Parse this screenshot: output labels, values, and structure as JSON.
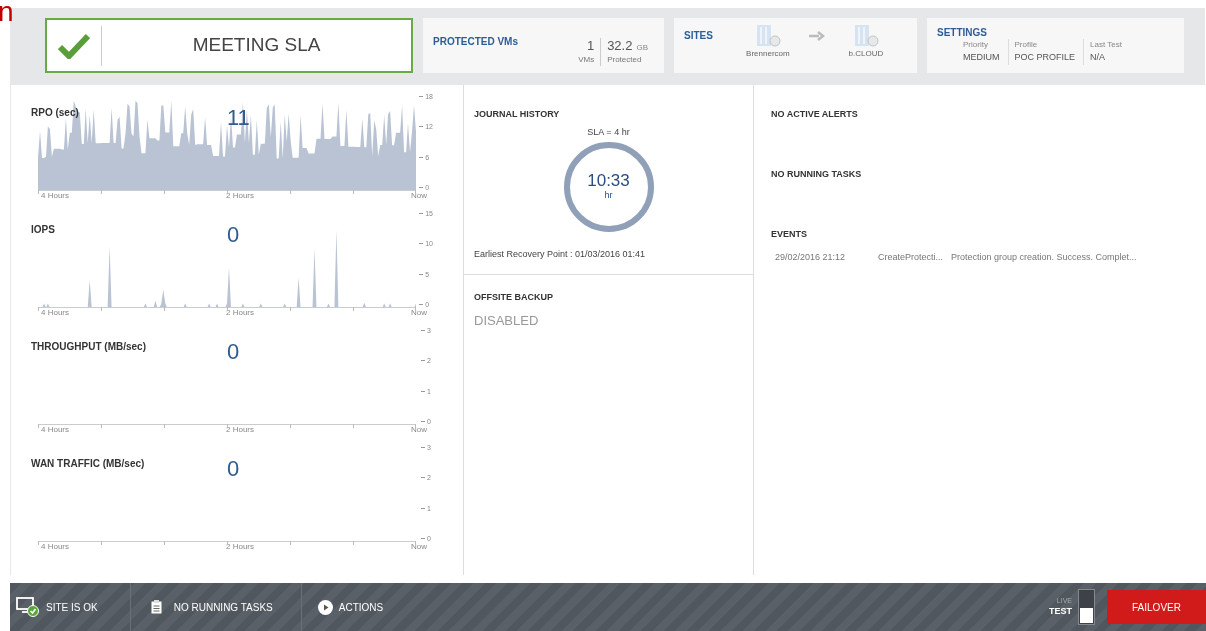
{
  "corner_text": "n",
  "sla_status": {
    "label": "MEETING SLA",
    "ok": true
  },
  "protected_vms": {
    "title": "PROTECTED VMs",
    "count": "1",
    "count_label": "VMs",
    "size": "32.2",
    "size_unit": "GB",
    "size_label": "Protected"
  },
  "sites": {
    "title": "SITES",
    "source": "Brennercom",
    "target": "b.CLOUD"
  },
  "settings": {
    "title": "SETTINGS",
    "items": [
      {
        "label": "Priority",
        "value": "MEDIUM"
      },
      {
        "label": "Profile",
        "value": "POC PROFILE"
      },
      {
        "label": "Last Test",
        "value": "N/A"
      }
    ]
  },
  "charts": [
    {
      "title": "RPO (sec)",
      "value": "11",
      "yticks": [
        "18",
        "12",
        "6",
        "0"
      ],
      "xlabels": [
        "4 Hours",
        "2 Hours",
        "Now"
      ],
      "kind": "dense"
    },
    {
      "title": "IOPS",
      "value": "0",
      "yticks": [
        "15",
        "10",
        "5",
        "0"
      ],
      "xlabels": [
        "4 Hours",
        "2 Hours",
        "Now"
      ],
      "kind": "spiky"
    },
    {
      "title": "THROUGHPUT (MB/sec)",
      "value": "0",
      "yticks": [
        "3",
        "2",
        "1",
        "0"
      ],
      "xlabels": [
        "4 Hours",
        "2 Hours",
        "Now"
      ],
      "kind": "flat"
    },
    {
      "title": "WAN TRAFFIC (MB/sec)",
      "value": "0",
      "yticks": [
        "3",
        "2",
        "1",
        "0"
      ],
      "xlabels": [
        "4 Hours",
        "2 Hours",
        "Now"
      ],
      "kind": "flat"
    }
  ],
  "journal": {
    "title": "JOURNAL HISTORY",
    "sla": "SLA = 4 hr",
    "value": "10:33",
    "unit": "hr",
    "earliest": "Earliest Recovery Point : 01/03/2016 01:41"
  },
  "offsite_backup": {
    "title": "OFFSITE BACKUP",
    "status": "DISABLED"
  },
  "alerts": {
    "title": "NO ACTIVE ALERTS"
  },
  "tasks": {
    "title": "NO RUNNING TASKS"
  },
  "events": {
    "title": "EVENTS",
    "rows": [
      {
        "time": "29/02/2016 21:12",
        "type": "CreateProtecti...",
        "description": "Protection group creation. Success. Complet..."
      }
    ]
  },
  "status_bar": {
    "site": "SITE IS OK",
    "tasks": "NO RUNNING TASKS",
    "actions": "ACTIONS",
    "mode": [
      {
        "label": "LIVE",
        "selected": false
      },
      {
        "label": "TEST",
        "selected": true
      }
    ],
    "failover": "FAILOVER"
  }
}
